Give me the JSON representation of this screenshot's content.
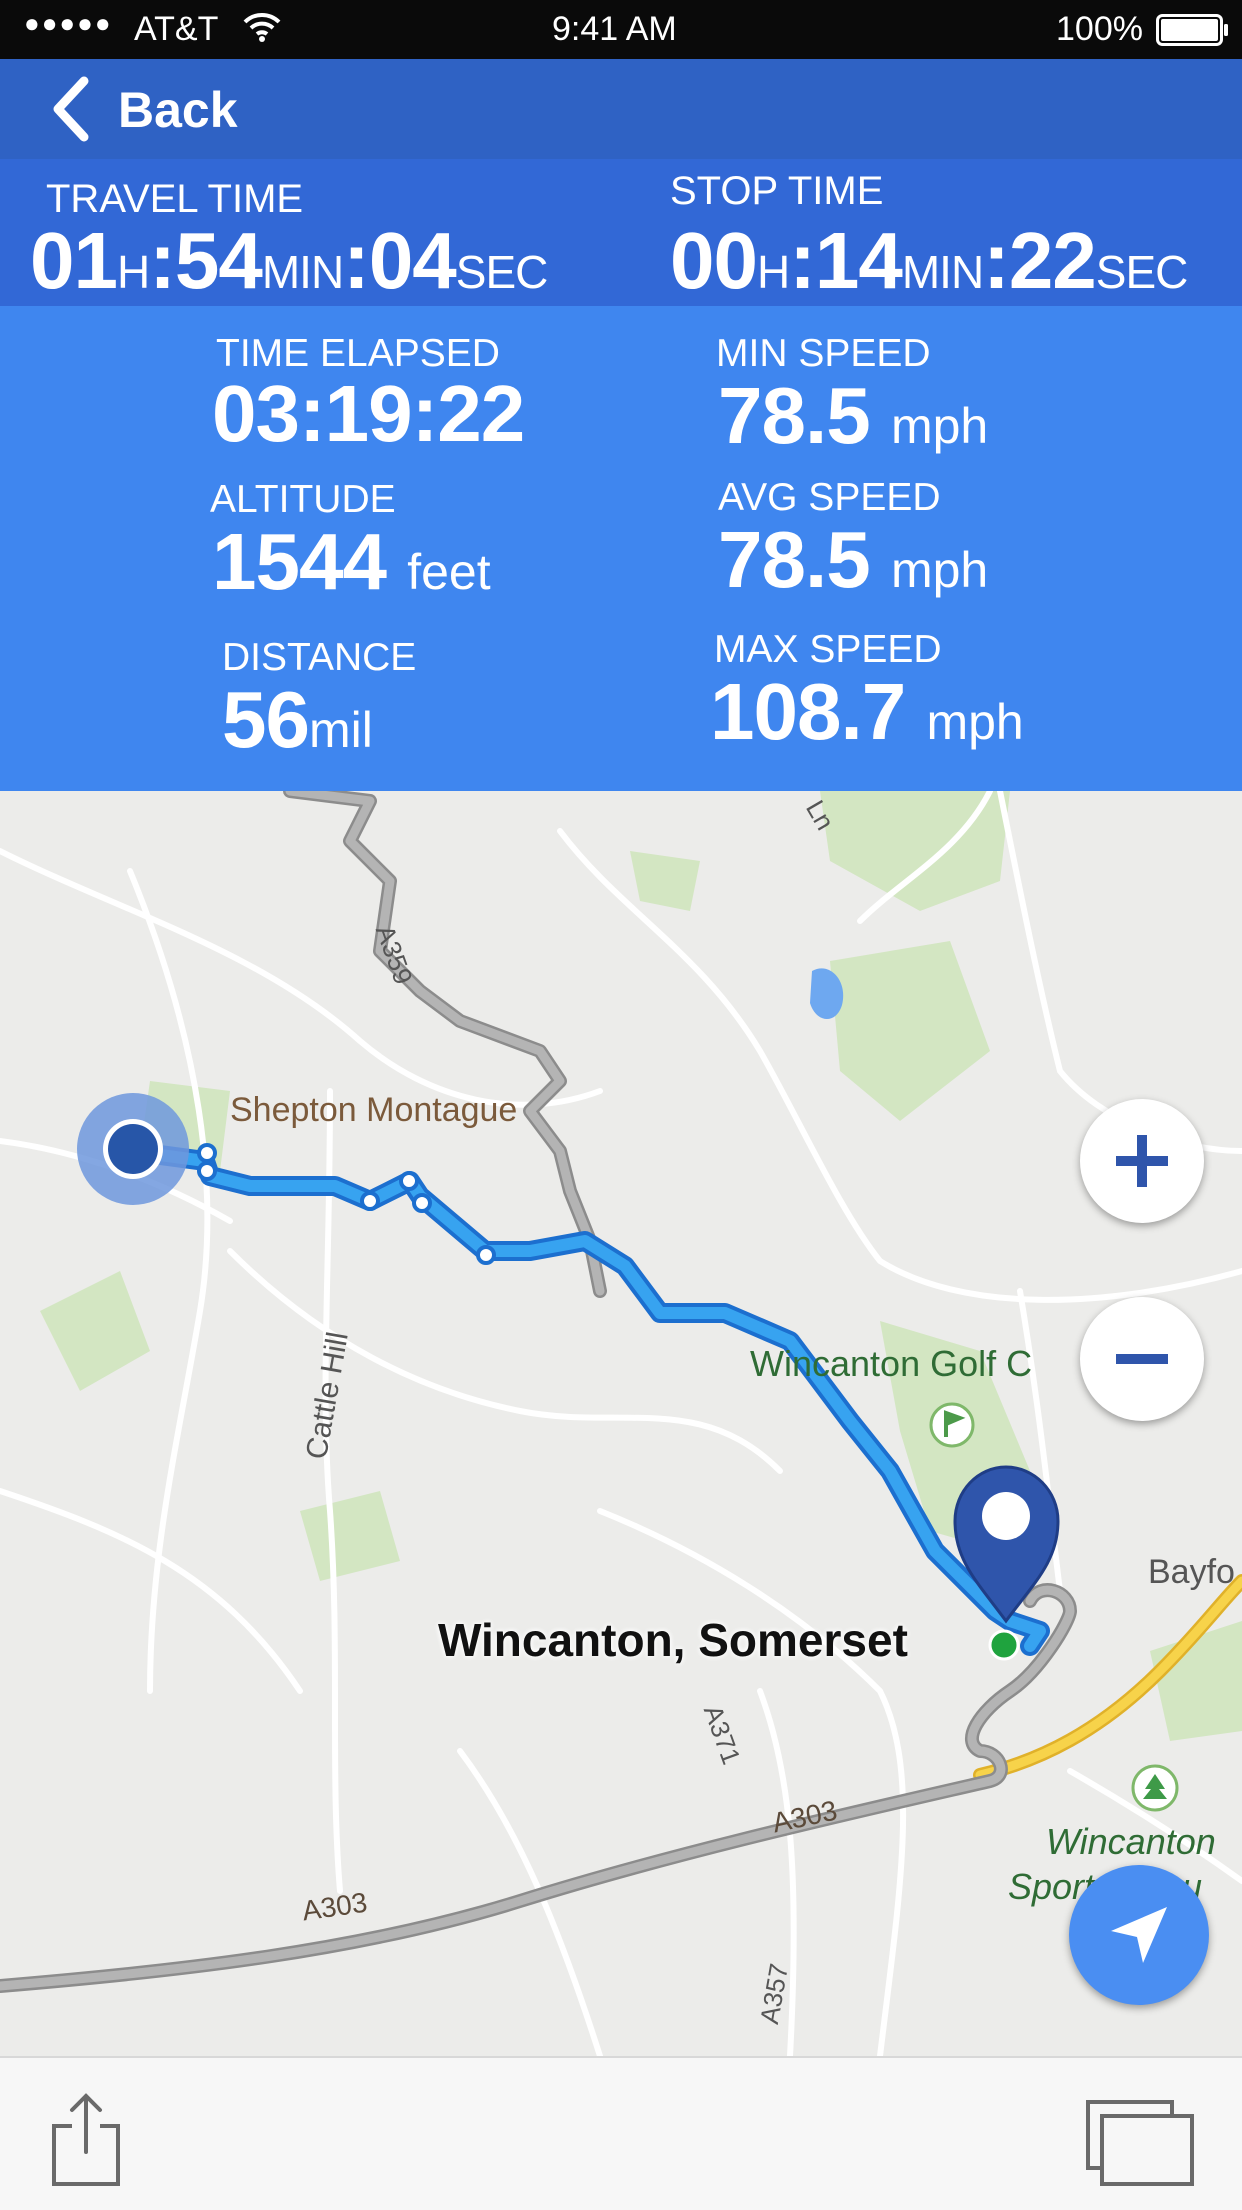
{
  "status_bar": {
    "signal_dots": "●●●●●",
    "carrier": "AT&T",
    "time": "9:41 AM",
    "battery_pct": "100%",
    "battery_level": 1.0,
    "icons": [
      "signal-dots-icon",
      "wifi-icon",
      "battery-icon"
    ]
  },
  "nav": {
    "back_label": "Back",
    "back_icon": "chevron-left-icon"
  },
  "travel": {
    "label": "TRAVEL TIME",
    "hours": "01",
    "h_unit": "H",
    "minutes": "54",
    "min_unit": "MIN",
    "seconds": "04",
    "sec_unit": "SEC"
  },
  "stop": {
    "label": "STOP TIME",
    "hours": "00",
    "h_unit": "H",
    "minutes": "14",
    "min_unit": "MIN",
    "seconds": "22",
    "sec_unit": "SEC"
  },
  "stats": {
    "time_elapsed": {
      "label": "TIME ELAPSED",
      "value": "03:19:22"
    },
    "altitude": {
      "label": "ALTITUDE",
      "value": "1544",
      "unit": "feet"
    },
    "distance": {
      "label": "DISTANCE",
      "value": "56",
      "unit": "mil"
    },
    "min_speed": {
      "label": "MIN SPEED",
      "value": "78.5",
      "unit": "mph"
    },
    "avg_speed": {
      "label": "AVG SPEED",
      "value": "78.5",
      "unit": "mph"
    },
    "max_speed": {
      "label": "MAX SPEED",
      "value": "108.7",
      "unit": "mph"
    }
  },
  "map": {
    "labels": {
      "shepton": "Shepton Montague",
      "a359": "A359",
      "cattle_hill": "Cattle Hill",
      "golf": "Wincanton Golf C",
      "bayford": "Bayfo",
      "destination": "Wincanton, Somerset",
      "a371": "A371",
      "a303_right": "A303",
      "a303_left": "A303",
      "a357": "A357",
      "sports_1": "Wincanton",
      "sports_2": "Sports Grou",
      "ln": "Ln"
    },
    "colors": {
      "route": "#2f9ae8",
      "road_major": "#9e9e9e",
      "road_yellow": "#f2c230",
      "park": "#cfe3be",
      "water": "#6ea8f0"
    },
    "controls": {
      "zoom_in": "+",
      "zoom_out": "−",
      "zoom_in_icon": "plus-icon",
      "zoom_out_icon": "minus-icon",
      "locate_icon": "navigation-arrow-icon"
    },
    "markers": [
      "start-location-dot",
      "destination-pin-icon",
      "destination-green-dot",
      "golf-icon",
      "tree-icon"
    ]
  },
  "toolbar": {
    "share_icon": "share-icon",
    "windows_icon": "windows-icon"
  }
}
